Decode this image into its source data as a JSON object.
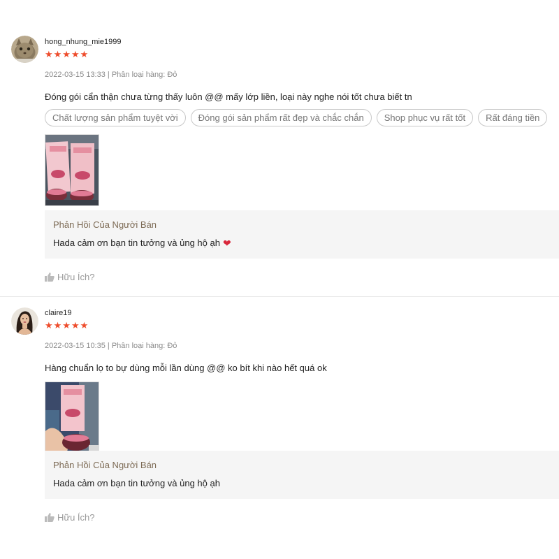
{
  "reviews": [
    {
      "username": "hong_nhung_mie1999",
      "stars": "★★★★★",
      "rating": 5,
      "meta": "2022-03-15 13:33 | Phân loại hàng: Đỏ",
      "comment": "Đóng gói cẩn thận chưa từng thấy luôn @@ mấy lớp liền, loại này nghe nói tốt chưa biết tn",
      "tags": [
        "Chất lượng sản phẩm tuyệt vời",
        "Đóng gói sản phẩm rất đẹp và chắc chắn",
        "Shop phục vụ rất tốt",
        "Rất đáng tiền"
      ],
      "reply_title": "Phản Hồi Của Người Bán",
      "reply_text": "Hada cảm ơn bạn tin tưởng và ủng hộ ạh",
      "helpful": "Hữu Ích?"
    },
    {
      "username": "claire19",
      "stars": "★★★★★",
      "rating": 5,
      "meta": "2022-03-15 10:35 | Phân loại hàng: Đỏ",
      "comment": "Hàng chuẩn lọ to bự dùng mỗi lần dùng @@ ko bít khi nào hết quá ok",
      "reply_title": "Phản Hồi Của Người Bán",
      "reply_text": "Hada cảm ơn bạn tin tưởng và ủng hộ ạh",
      "helpful": "Hữu Ích?"
    }
  ],
  "colors": {
    "star": "#ee4d2d",
    "reply_title": "#7d6b55",
    "reply_bg": "#f5f5f5",
    "heart": "#d9283c"
  }
}
